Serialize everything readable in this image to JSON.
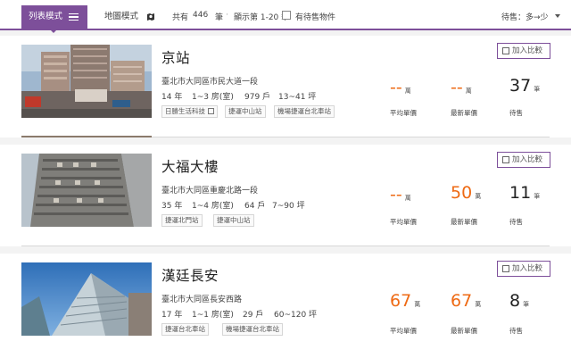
{
  "toolbar": {
    "list_tab": "列表模式",
    "map_tab": "地圖模式",
    "total_prefix": "共有",
    "total_count": "446",
    "total_suffix": "筆",
    "separator": "‧",
    "range_text": "顯示第 1-20 筆",
    "sale_filter": "有待售物件",
    "sort_label": "待售：多→少"
  },
  "listings": [
    {
      "name": "京站",
      "address": "臺北市大同區市民大道一段",
      "age": "14 年",
      "rooms": "1~3 房(室)",
      "households": "979 戶",
      "area": "13~41 坪",
      "tags": [
        "日勝生活科技",
        "捷運中山站",
        "機場捷運台北車站"
      ],
      "compare_label": "加入比較",
      "avg_price": "--",
      "avg_unit": "萬",
      "latest_price": "--",
      "latest_unit": "萬",
      "for_sale": "37",
      "for_sale_unit": "筆",
      "avg_label": "平均單價",
      "latest_label": "最新單價",
      "sale_label": "待售"
    },
    {
      "name": "大福大樓",
      "address": "臺北市大同區重慶北路一段",
      "age": "35 年",
      "rooms": "1~4 房(室)",
      "households": "64 戶",
      "area": "7~90 坪",
      "tags": [
        "捷運北門站",
        "捷運中山站"
      ],
      "compare_label": "加入比較",
      "avg_price": "--",
      "avg_unit": "萬",
      "latest_price": "50",
      "latest_unit": "萬",
      "for_sale": "11",
      "for_sale_unit": "筆",
      "avg_label": "平均單價",
      "latest_label": "最新單價",
      "sale_label": "待售"
    },
    {
      "name": "漢廷長安",
      "address": "臺北市大同區長安西路",
      "age": "17 年",
      "rooms": "1~1 房(室)",
      "households": "29 戶",
      "area": "60~120 坪",
      "tags": [
        "捷運台北車站",
        "機場捷運台北車站"
      ],
      "compare_label": "加入比較",
      "avg_price": "67",
      "avg_unit": "萬",
      "latest_price": "67",
      "latest_unit": "萬",
      "for_sale": "8",
      "for_sale_unit": "筆",
      "avg_label": "平均單價",
      "latest_label": "最新單價",
      "sale_label": "待售"
    }
  ],
  "colors": {
    "accent": "#7d4f9a",
    "price_orange": "#ee6a14"
  }
}
